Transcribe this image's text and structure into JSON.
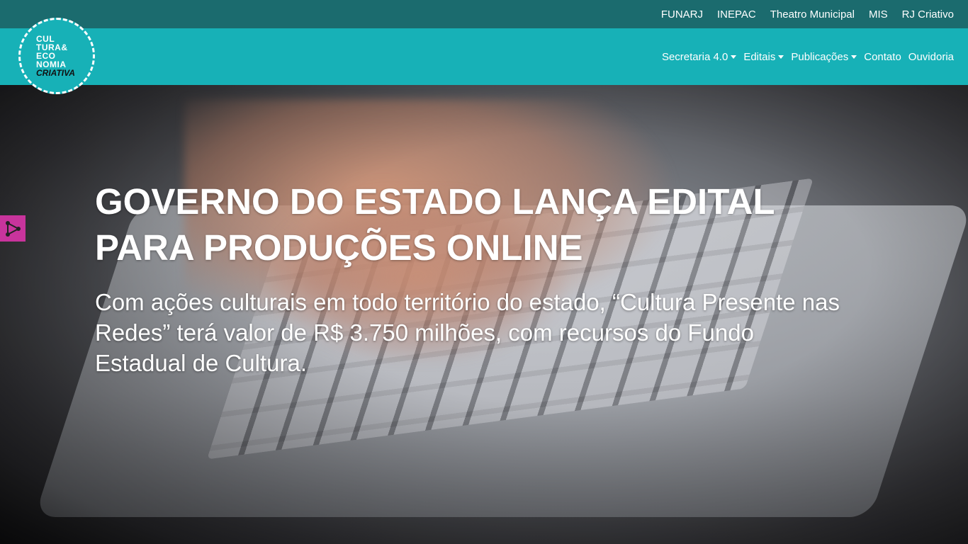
{
  "topbar": {
    "links": [
      "FUNARJ",
      "INEPAC",
      "Theatro Municipal",
      "MIS",
      "RJ Criativo"
    ]
  },
  "logo": {
    "line1": "CUL",
    "line2": "TURA&",
    "line3": "ECO",
    "line4": "NOMIA",
    "line5": "CRIATIVA"
  },
  "nav": {
    "items": [
      {
        "label": "Secretaria 4.0",
        "dropdown": true
      },
      {
        "label": "Editais",
        "dropdown": true
      },
      {
        "label": "Publicações",
        "dropdown": true
      },
      {
        "label": "Contato",
        "dropdown": false
      },
      {
        "label": "Ouvidoria",
        "dropdown": false
      }
    ]
  },
  "hero": {
    "title": "GOVERNO DO ESTADO LANÇA EDITAL PARA PRODUÇÕES ONLINE",
    "subtitle": "Com ações culturais em todo território do estado, “Cultura Presente nas Redes” terá valor de R$ 3.750 milhões, com recursos do Fundo Estadual de Cultura."
  },
  "share": {
    "icon": "share-icon"
  },
  "colors": {
    "topbar": "#1b6b6e",
    "navbar": "#17b1b7",
    "share": "#c8349c"
  }
}
